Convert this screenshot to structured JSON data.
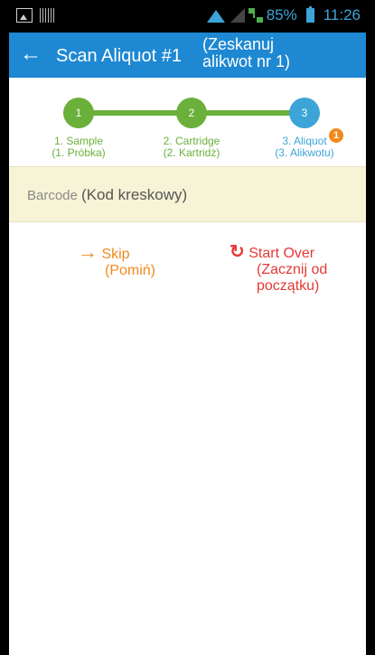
{
  "status_bar": {
    "battery_percent": "85%",
    "time": "11:26",
    "icons": [
      "image-icon",
      "barcode-icon",
      "wifi-icon",
      "signal-icon",
      "network-icon",
      "battery-icon"
    ]
  },
  "app_bar": {
    "back_icon": "←",
    "title": "Scan Aliquot #1",
    "title_translation_line1": "(Zeskanuj",
    "title_translation_line2": "alikwot nr 1)",
    "color": "#1e88d2"
  },
  "stepper": {
    "steps": [
      {
        "number": "1",
        "label_line1": "1. Sample",
        "label_line2": "(1. Próbka)",
        "state": "complete",
        "color": "#6ab03a"
      },
      {
        "number": "2",
        "label_line1": "2. Cartridge",
        "label_line2": "(2. Kartridż)",
        "state": "complete",
        "color": "#6ab03a"
      },
      {
        "number": "3",
        "label_line1": "3. Aliquot",
        "label_line2": "(3. Alikwotu)",
        "state": "active",
        "color": "#3da4d8",
        "badge": "1"
      }
    ]
  },
  "barcode": {
    "placeholder": "Barcode",
    "placeholder_translation": "(Kod kreskowy)"
  },
  "actions": {
    "skip_icon": "→",
    "skip_label": "Skip",
    "skip_translation": "(Pomiń)",
    "start_over_icon": "↻",
    "start_over_label": "Start Over",
    "start_over_translation_line1": "(Zacznij od",
    "start_over_translation_line2": "początku)"
  }
}
